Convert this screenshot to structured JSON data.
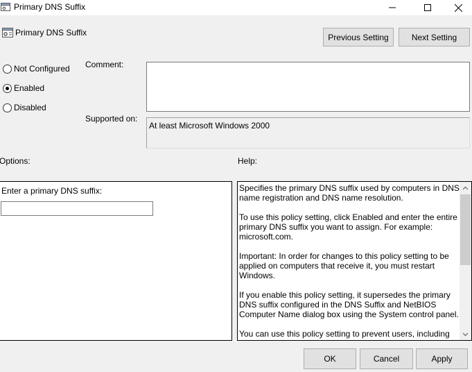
{
  "window": {
    "title": "Primary DNS Suffix",
    "icon": "policy-settings-icon",
    "controls": [
      "minimize-icon",
      "maximize-icon",
      "close-icon"
    ]
  },
  "header": {
    "policy_name": "Primary DNS Suffix",
    "previous_label": "Previous Setting",
    "next_label": "Next Setting"
  },
  "state": {
    "options": [
      {
        "label": "Not Configured",
        "checked": false
      },
      {
        "label": "Enabled",
        "checked": true
      },
      {
        "label": "Disabled",
        "checked": false
      }
    ]
  },
  "comment": {
    "label": "Comment:",
    "value": ""
  },
  "supported": {
    "label": "Supported on:",
    "value": "At least Microsoft Windows 2000"
  },
  "options_panel": {
    "heading": "Options:",
    "field_label": "Enter a primary DNS suffix:",
    "field_value": ""
  },
  "help_panel": {
    "heading": "Help:",
    "paragraphs": [
      "Specifies the primary DNS suffix used by computers in DNS name registration and DNS name resolution.",
      "To use this policy setting, click Enabled and enter the entire primary DNS suffix you want to assign. For example: microsoft.com.",
      "Important: In order for changes to this policy setting to be applied on computers that receive it, you must restart Windows.",
      "If you enable this policy setting, it supersedes the primary DNS suffix configured in the DNS Suffix and NetBIOS Computer Name dialog box using the System control panel.",
      "You can use this policy setting to prevent users, including"
    ]
  },
  "footer": {
    "ok_label": "OK",
    "cancel_label": "Cancel",
    "apply_label": "Apply"
  },
  "colors": {
    "window_bg": "#f0f0f0",
    "button_bg": "#e1e1e1",
    "button_border": "#adadad"
  }
}
